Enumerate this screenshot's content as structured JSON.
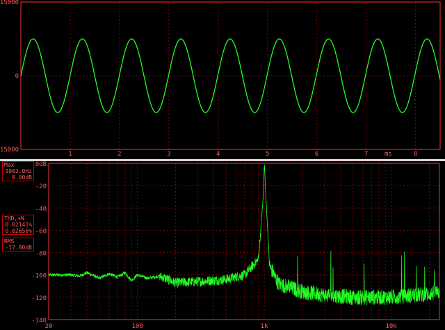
{
  "oscilloscope": {
    "y_tick_labels": [
      "15000",
      "0",
      "-15000"
    ],
    "x_tick_labels": [
      "1",
      "2",
      "3",
      "4",
      "5",
      "6",
      "7",
      "8"
    ],
    "x_unit": "ms"
  },
  "spectrum": {
    "y_tick_labels": [
      "0dB",
      "-20",
      "-40",
      "-60",
      "-80",
      "-100",
      "-120",
      "-140"
    ],
    "x_tick_labels": [
      "20",
      "100",
      "1k",
      "10k"
    ]
  },
  "readouts": {
    "max": {
      "title": "Max",
      "values": [
        "1002.0Hz",
        "0.00dB"
      ]
    },
    "thd": {
      "title": "THD,+N",
      "values": [
        "0.02141%",
        "0.02656%"
      ]
    },
    "rms": {
      "title": "RMS",
      "values": [
        "-17.80dB"
      ]
    }
  },
  "colors": {
    "trace": "#22ff22",
    "grid": "#8b0000",
    "frame": "#ff3030",
    "text": "#ff5a5a"
  },
  "chart_data": [
    {
      "type": "line",
      "title": "",
      "xlabel": "ms",
      "ylabel": "",
      "xlim": [
        0,
        8.5
      ],
      "ylim": [
        -15000,
        15000
      ],
      "series": [
        {
          "frequency_hz": 1002,
          "amplitude": 7500,
          "offset": 0
        }
      ],
      "grid": true
    },
    {
      "type": "line",
      "title": "",
      "xlabel": "",
      "ylabel": "",
      "x_scale": "log",
      "xlim": [
        20,
        24000
      ],
      "ylim": [
        -140,
        0
      ],
      "series": [
        {
          "x": [
            20,
            30,
            35,
            40,
            50,
            60,
            70,
            80,
            90,
            100,
            120,
            150,
            200,
            300,
            500,
            700,
            900,
            980,
            1002,
            1030,
            1100,
            1300,
            2000,
            3000,
            5000,
            10000,
            20000,
            24000
          ],
          "y": [
            -100,
            -100,
            -101,
            -98,
            -103,
            -99,
            -102,
            -98,
            -105,
            -100,
            -103,
            -101,
            -107,
            -106,
            -104,
            -100,
            -86,
            -30,
            0,
            -30,
            -92,
            -108,
            -115,
            -118,
            -120,
            -120,
            -117,
            -115
          ]
        }
      ],
      "grid": true
    }
  ]
}
